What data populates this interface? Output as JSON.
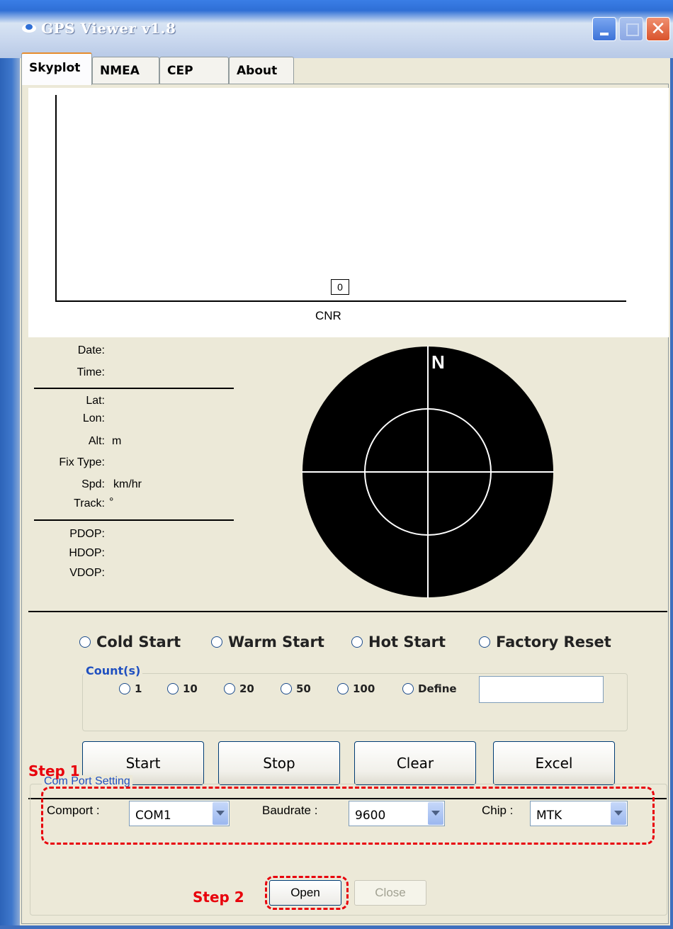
{
  "window": {
    "title": "GPS Viewer v1.8"
  },
  "tabs": [
    "Skyplot",
    "NMEA",
    "CEP",
    "About"
  ],
  "cnr_plot": {
    "axis_label": "CNR",
    "satellite_value": "0"
  },
  "info": {
    "date_label": "Date:",
    "time_label": "Time:",
    "lat_label": "Lat:",
    "lon_label": "Lon:",
    "alt_label": "Alt:",
    "alt_unit": "m",
    "fix_label": "Fix Type:",
    "spd_label": "Spd:",
    "spd_unit": "km/hr",
    "track_label": "Track:",
    "track_unit": "°",
    "pdop_label": "PDOP:",
    "hdop_label": "HDOP:",
    "vdop_label": "VDOP:"
  },
  "skyplot": {
    "north_label": "N"
  },
  "start_modes": [
    "Cold Start",
    "Warm Start",
    "Hot Start",
    "Factory Reset"
  ],
  "count": {
    "title": "Count(s)",
    "options": [
      "1",
      "10",
      "20",
      "50",
      "100",
      "Define"
    ],
    "define_value": ""
  },
  "actions": [
    "Start",
    "Stop",
    "Clear",
    "Excel"
  ],
  "com_port": {
    "title": "Com Port Setting",
    "comport_label": "Comport :",
    "comport_value": "COM1",
    "baud_label": "Baudrate :",
    "baud_value": "9600",
    "chip_label": "Chip :",
    "chip_value": "MTK",
    "open_label": "Open",
    "close_label": "Close"
  },
  "annotations": {
    "step1": "Step 1",
    "step2": "Step 2"
  }
}
